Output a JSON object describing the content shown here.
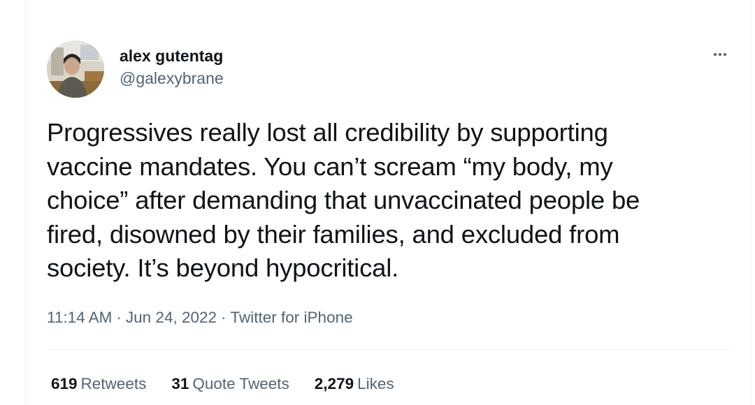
{
  "tweet": {
    "author": {
      "display_name": "alex gutentag",
      "handle": "@galexybrane"
    },
    "more_icon": "more-horizontal-icon",
    "text_lines": [
      "Progressives really lost all credibility by supporting",
      "vaccine mandates. You can’t scream “my body, my",
      "choice” after demanding that unvaccinated people be",
      "fired, disowned by their families, and excluded from",
      "society. It’s beyond hypocritical."
    ],
    "time": "11:14 AM",
    "date": "Jun 24, 2022",
    "source": "Twitter for iPhone",
    "separator": "·",
    "stats": {
      "retweets_count": "619",
      "retweets_label": "Retweets",
      "quotes_count": "31",
      "quotes_label": "Quote Tweets",
      "likes_count": "2,279",
      "likes_label": "Likes"
    }
  },
  "colors": {
    "text_primary": "#0f1419",
    "text_secondary": "#536471",
    "divider": "#eff3f4"
  }
}
